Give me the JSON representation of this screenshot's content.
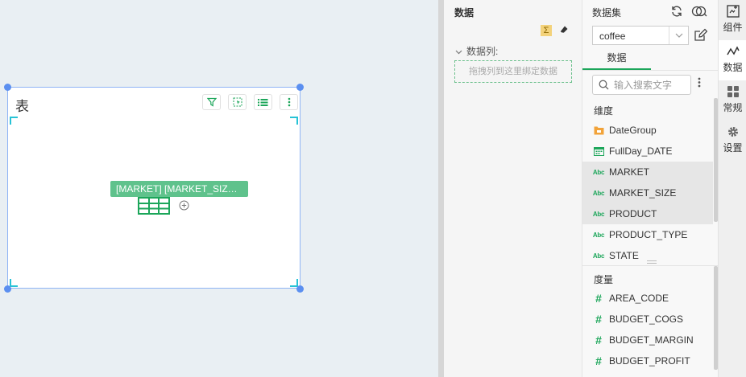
{
  "canvas": {
    "widget_title": "表",
    "field_tag": "[MARKET] [MARKET_SIZ…"
  },
  "data_config": {
    "title": "数据",
    "sigma_label": "Σ",
    "columns_label": "数据列:",
    "drop_hint": "拖拽列到这里绑定数据"
  },
  "dataset": {
    "title": "数据集",
    "selected": "coffee",
    "tab": "数据",
    "search_placeholder": "输入搜索文字",
    "dimensions_label": "维度",
    "measures_label": "度量",
    "dimensions": [
      {
        "name": "DateGroup",
        "icon": "folder-date-icon"
      },
      {
        "name": "FullDay_DATE",
        "icon": "calendar-icon"
      },
      {
        "name": "MARKET",
        "icon": "abc-icon",
        "selected": true
      },
      {
        "name": "MARKET_SIZE",
        "icon": "abc-icon",
        "selected": true
      },
      {
        "name": "PRODUCT",
        "icon": "abc-icon",
        "selected": true
      },
      {
        "name": "PRODUCT_TYPE",
        "icon": "abc-icon"
      },
      {
        "name": "STATE",
        "icon": "abc-icon"
      }
    ],
    "measures": [
      {
        "name": "AREA_CODE",
        "icon": "hash-icon"
      },
      {
        "name": "BUDGET_COGS",
        "icon": "hash-icon"
      },
      {
        "name": "BUDGET_MARGIN",
        "icon": "hash-icon"
      },
      {
        "name": "BUDGET_PROFIT",
        "icon": "hash-icon"
      }
    ],
    "abc_text": "Abc",
    "hash_text": "#"
  },
  "right_bar": {
    "components": "组件",
    "data": "数据",
    "general": "常规",
    "settings": "设置"
  },
  "colors": {
    "accent": "#1ca65a",
    "tag": "#5fc28c",
    "selection": "#5b8ff0"
  }
}
